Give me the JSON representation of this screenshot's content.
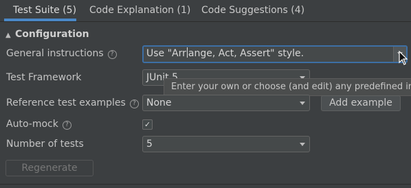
{
  "tabs": [
    {
      "label": "Test Suite (5)"
    },
    {
      "label": "Code Explanation (1)"
    },
    {
      "label": "Code Suggestions (4)"
    }
  ],
  "configuration": {
    "title": "Configuration",
    "general_instructions": {
      "label": "General instructions",
      "value_before_caret": "Use \"Arr",
      "value_after_caret": "ange, Act, Assert\" style."
    },
    "test_framework": {
      "label": "Test Framework",
      "value": "JUnit 5"
    },
    "reference_examples": {
      "label": "Reference test examples",
      "value": "None",
      "button": "Add example"
    },
    "auto_mock": {
      "label": "Auto-mock",
      "checked": true,
      "check_glyph": "✓"
    },
    "number_of_tests": {
      "label": "Number of tests",
      "value": "5"
    },
    "regenerate_button": "Regenerate",
    "help_glyph": "?"
  },
  "tooltip": "Enter your own or choose (and edit) any predefined instructions",
  "colors": {
    "accent": "#4a88c7",
    "background": "#3c3f41",
    "focus": "#3d6fa5"
  }
}
